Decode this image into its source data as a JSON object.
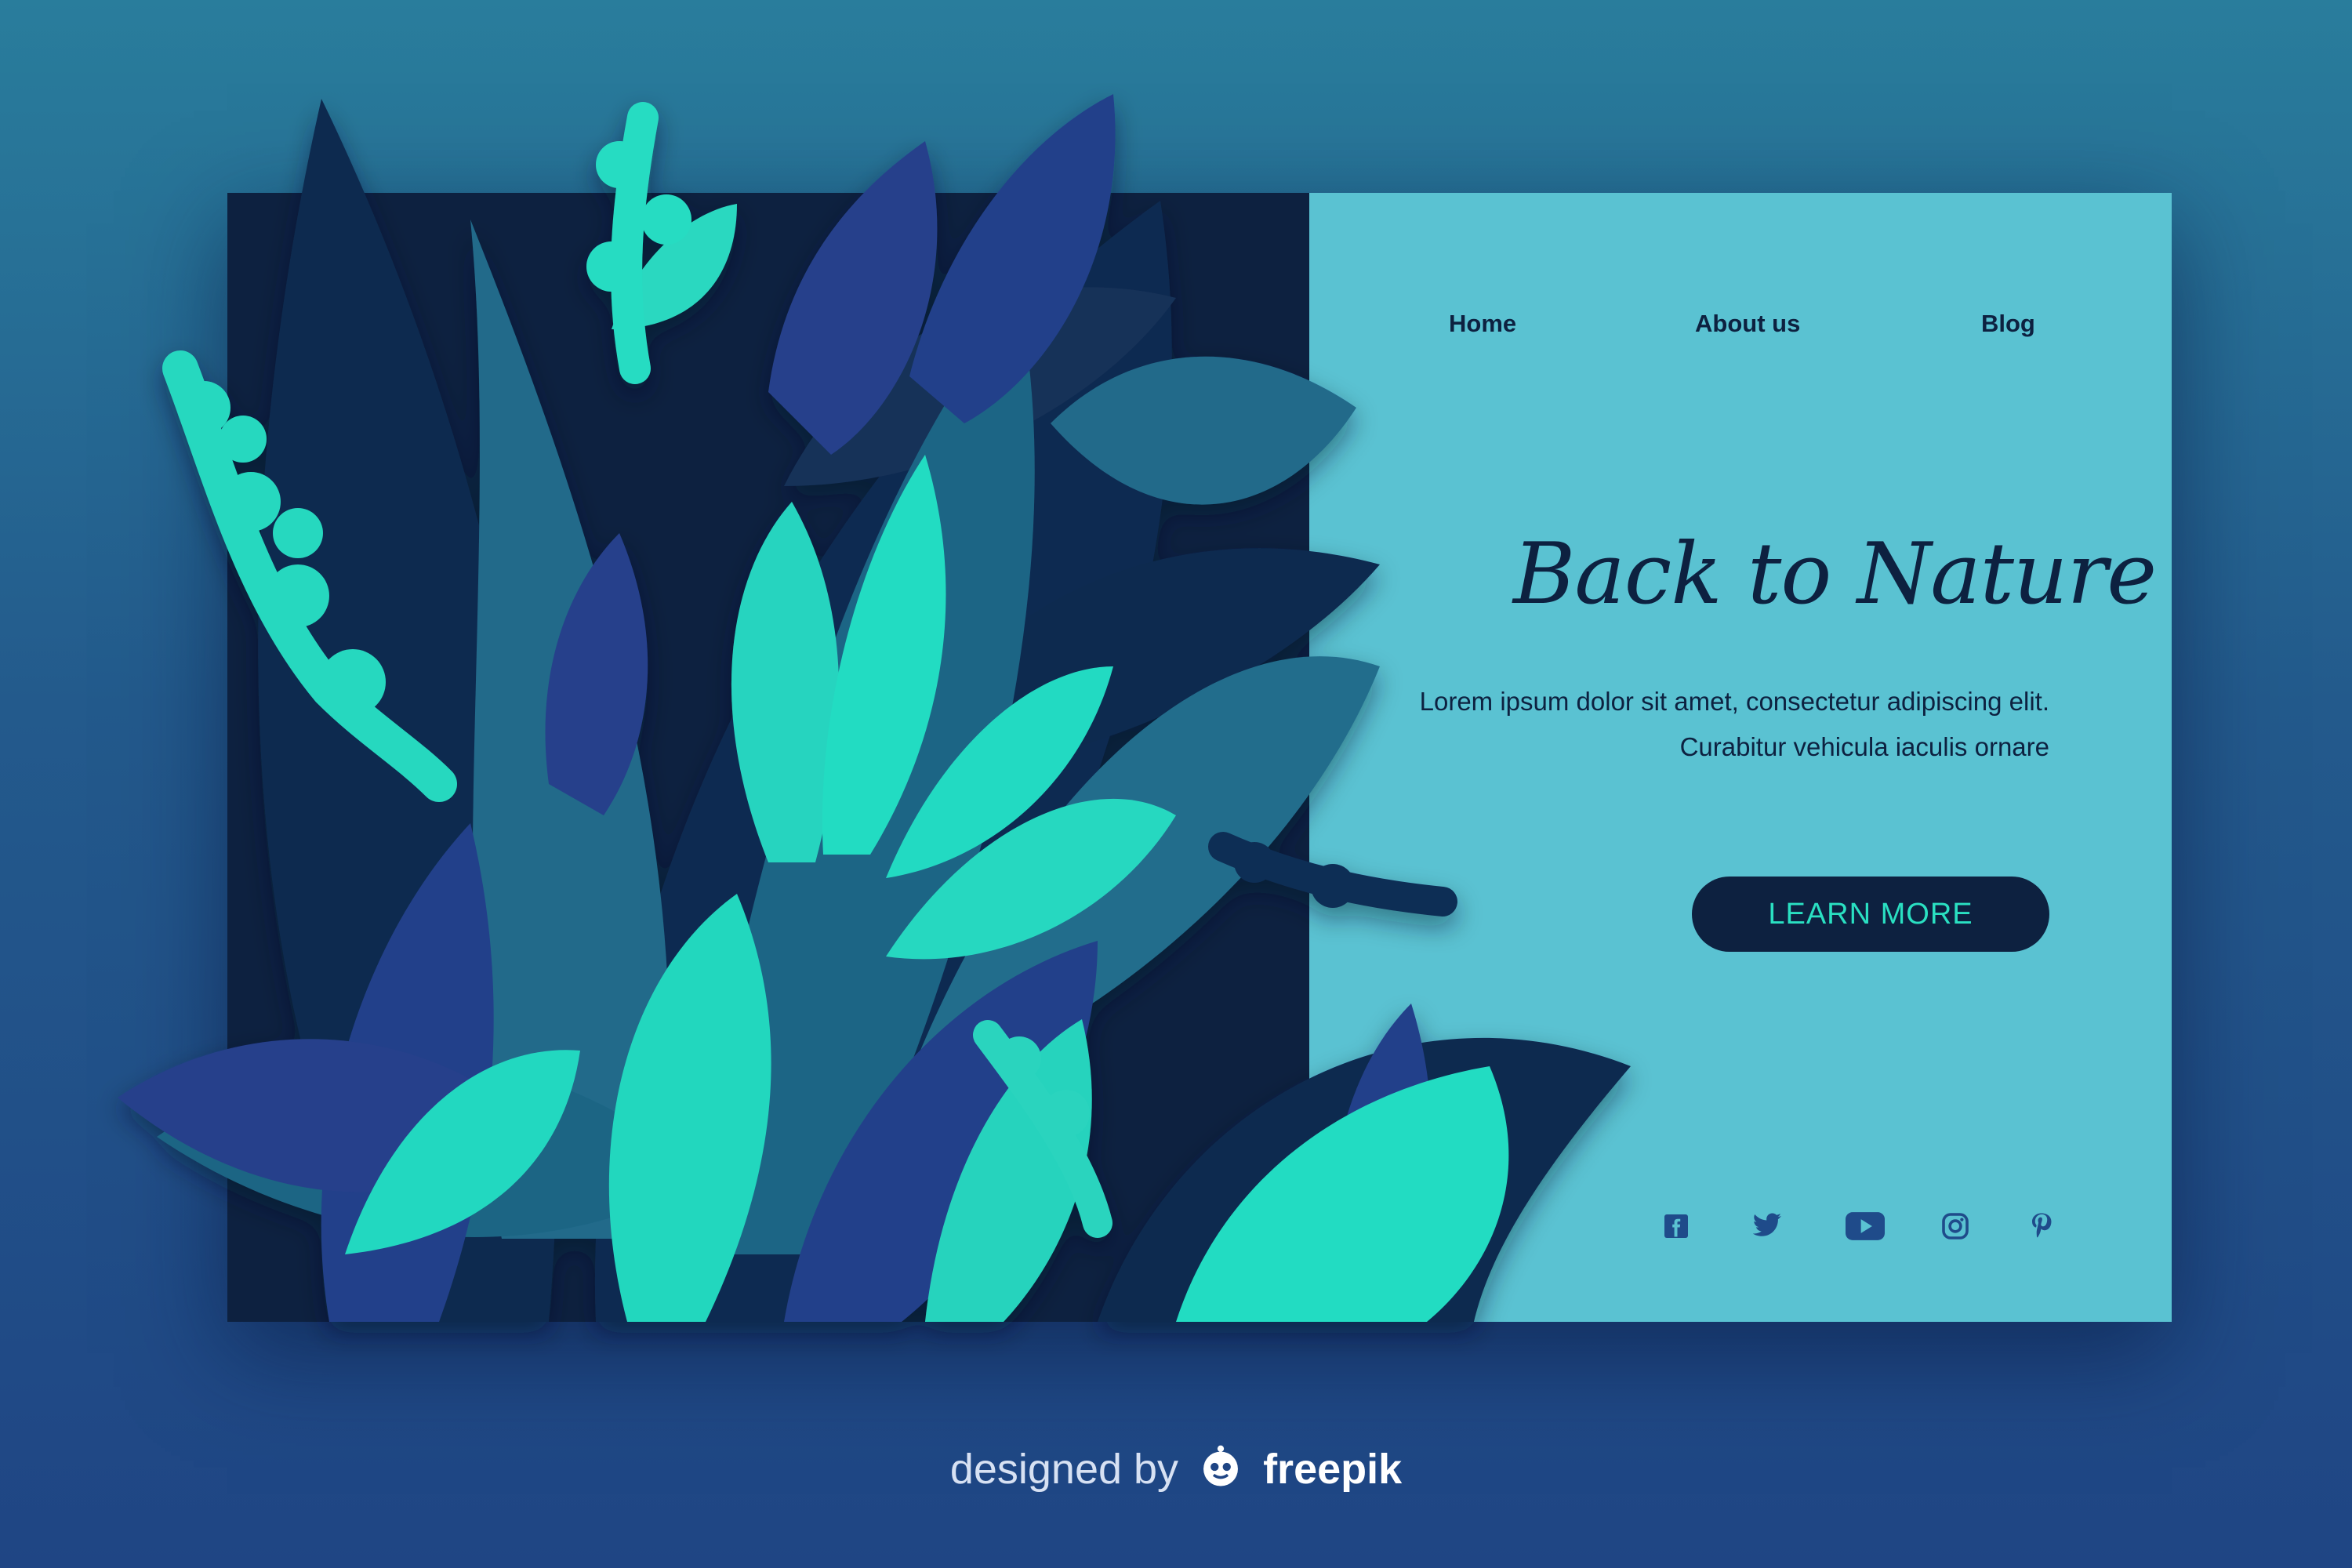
{
  "nav": {
    "home": "Home",
    "about": "About us",
    "blog": "Blog"
  },
  "hero": {
    "title": "Back to Nature",
    "description": "Lorem ipsum dolor sit amet, consectetur adipiscing elit. Curabitur vehicula iaculis ornare",
    "cta_label": "LEARN MORE"
  },
  "social": [
    "facebook-icon",
    "twitter-icon",
    "youtube-icon",
    "instagram-icon",
    "pinterest-icon"
  ],
  "footer": {
    "designed_by": "designed by",
    "brand": "freepik"
  },
  "colors": {
    "background_top": "#297d9c",
    "background_bottom": "#1f4584",
    "panel": "#5ac2d2",
    "navy": "#0d2140",
    "accent": "#2ae0c2"
  }
}
